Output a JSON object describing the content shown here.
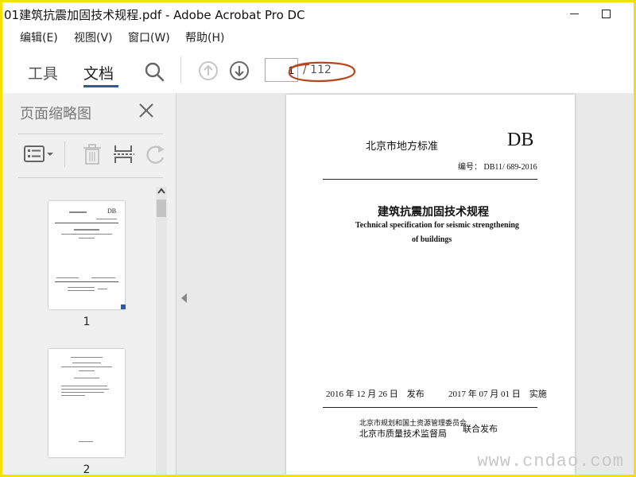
{
  "window": {
    "title": "01建筑抗震加固技术规程.pdf - Adobe Acrobat Pro DC"
  },
  "menu": {
    "items": [
      "编辑(E)",
      "视图(V)",
      "窗口(W)",
      "帮助(H)"
    ]
  },
  "toolbar": {
    "tabs": [
      "工具",
      "文档"
    ],
    "active_tab": "文档",
    "page_current": "1",
    "page_total": "/ 112",
    "annotation_color": "#b4471e"
  },
  "panel": {
    "title": "页面缩略图",
    "thumbnails": [
      {
        "number": "1",
        "selected": true
      },
      {
        "number": "2",
        "selected": false
      }
    ]
  },
  "document": {
    "header_left": "北京市地方标准",
    "header_right": "DB",
    "code": "编号： DB11/ 689-2016",
    "title_cn": "建筑抗震加固技术规程",
    "title_en_line1": "Technical specification for seismic strengthening",
    "title_en_line2": "of buildings",
    "issue_date": "2016 年 12 月 26 日　发布",
    "effective_date": "2017 年 07 月 01 日　实施",
    "publisher_line1": "北京市规划和国土资源管理委员会",
    "publisher_line2": "北京市质量技术监督局",
    "joint_publish": "联合发布"
  },
  "watermark": "www.cndao.com",
  "colors": {
    "frame": "#f5e000",
    "accent": "#2c5aa0"
  }
}
